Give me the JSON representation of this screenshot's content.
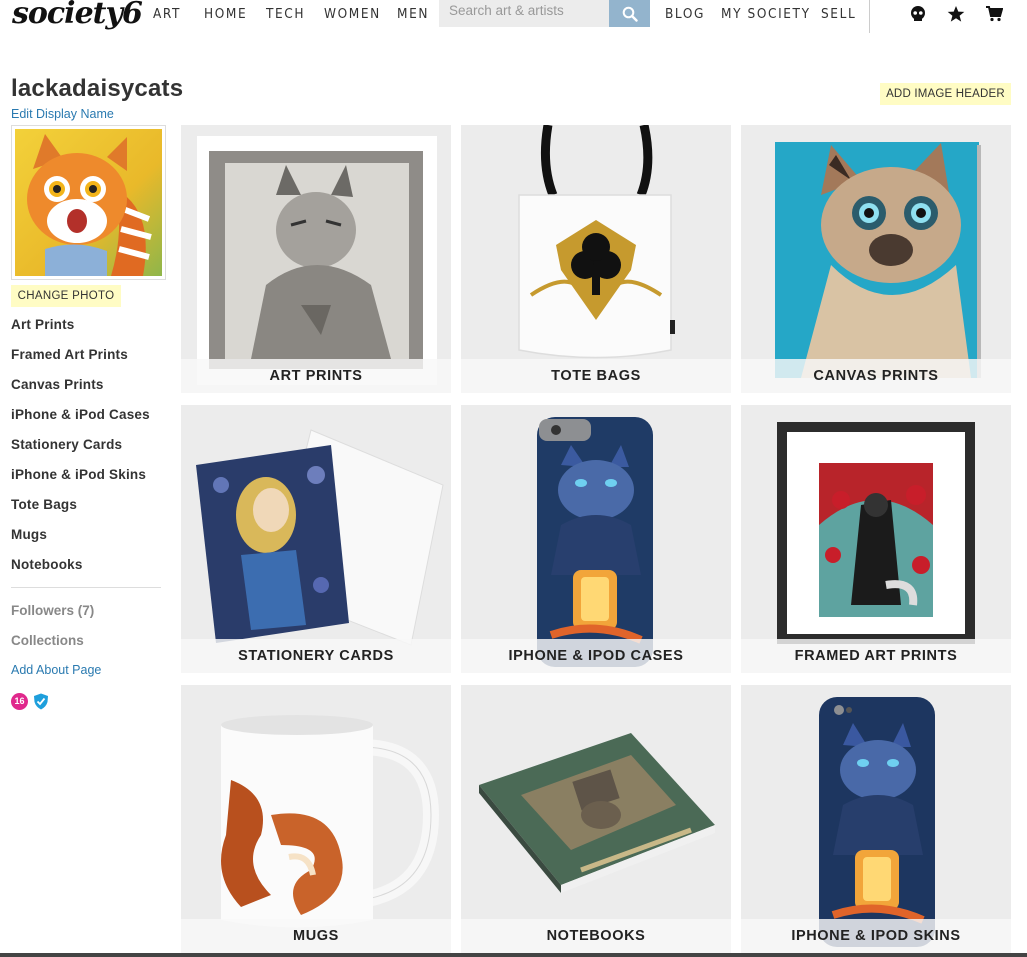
{
  "brand": {
    "logo_text": "society6",
    "accent": "#93b4cd",
    "highlight": "#fffcc4",
    "link_color": "#2a7ab0"
  },
  "nav": {
    "left_links": [
      "ART",
      "HOME",
      "TECH",
      "WOMEN",
      "MEN"
    ],
    "search_placeholder": "Search art & artists",
    "right_links": [
      "BLOG",
      "MY SOCIETY",
      "SELL"
    ],
    "icons": [
      "skull-icon",
      "star-icon",
      "cart-icon"
    ]
  },
  "profile": {
    "username": "lackadaisycats",
    "edit_display_name": "Edit Display Name",
    "change_photo": "CHANGE PHOTO",
    "add_image_header": "ADD IMAGE HEADER",
    "badge_count": "16"
  },
  "sidebar": {
    "products": [
      "Art Prints",
      "Framed Art Prints",
      "Canvas Prints",
      "iPhone & iPod Cases",
      "Stationery Cards",
      "iPhone & iPod Skins",
      "Tote Bags",
      "Mugs",
      "Notebooks"
    ],
    "followers": "Followers (7)",
    "collections": "Collections",
    "add_about": "Add About Page"
  },
  "grid": [
    {
      "label": "ART PRINTS"
    },
    {
      "label": "TOTE BAGS"
    },
    {
      "label": "CANVAS PRINTS"
    },
    {
      "label": "STATIONERY CARDS"
    },
    {
      "label": "IPHONE & IPOD CASES"
    },
    {
      "label": "FRAMED ART PRINTS"
    },
    {
      "label": "MUGS"
    },
    {
      "label": "NOTEBOOKS"
    },
    {
      "label": "IPHONE & IPOD SKINS"
    }
  ]
}
